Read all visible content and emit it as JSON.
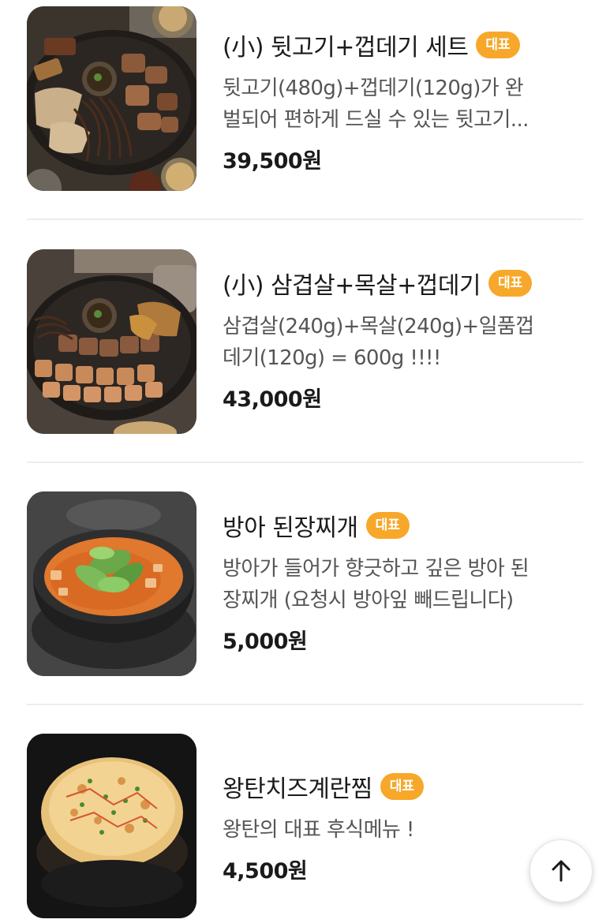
{
  "menu": {
    "items": [
      {
        "title": "(小) 뒷고기+껍데기 세트",
        "badge": "대표",
        "description": "뒷고기(480g)+껍데기(120g)가 완\n벌되어 편하게 드실 수 있는 뒷고기...",
        "price": "39,500원",
        "image": "grilled-pork-platter"
      },
      {
        "title": "(小) 삼겹살+목살+껍데기",
        "badge": "대표",
        "description": "삼겹살(240g)+목살(240g)+일품껍\n데기(120g) = 600g !!!!",
        "price": "43,000원",
        "image": "pork-belly-neck-skin-platter"
      },
      {
        "title": "방아 된장찌개",
        "badge": "대표",
        "description": "방아가 들어가 향긋하고 깊은 방아 된\n장찌개 (요청시 방아잎 빼드립니다)",
        "price": "5,000원",
        "image": "soybean-paste-stew"
      },
      {
        "title": "왕탄치즈계란찜",
        "badge": "대표",
        "description": "왕탄의 대표 후식메뉴 !",
        "price": "4,500원",
        "image": "cheese-steamed-egg"
      }
    ]
  },
  "colors": {
    "badge": "#f7a82a",
    "divider": "#ededed",
    "description": "#555555"
  },
  "scroll_top": {
    "icon": "arrow-up-icon"
  }
}
